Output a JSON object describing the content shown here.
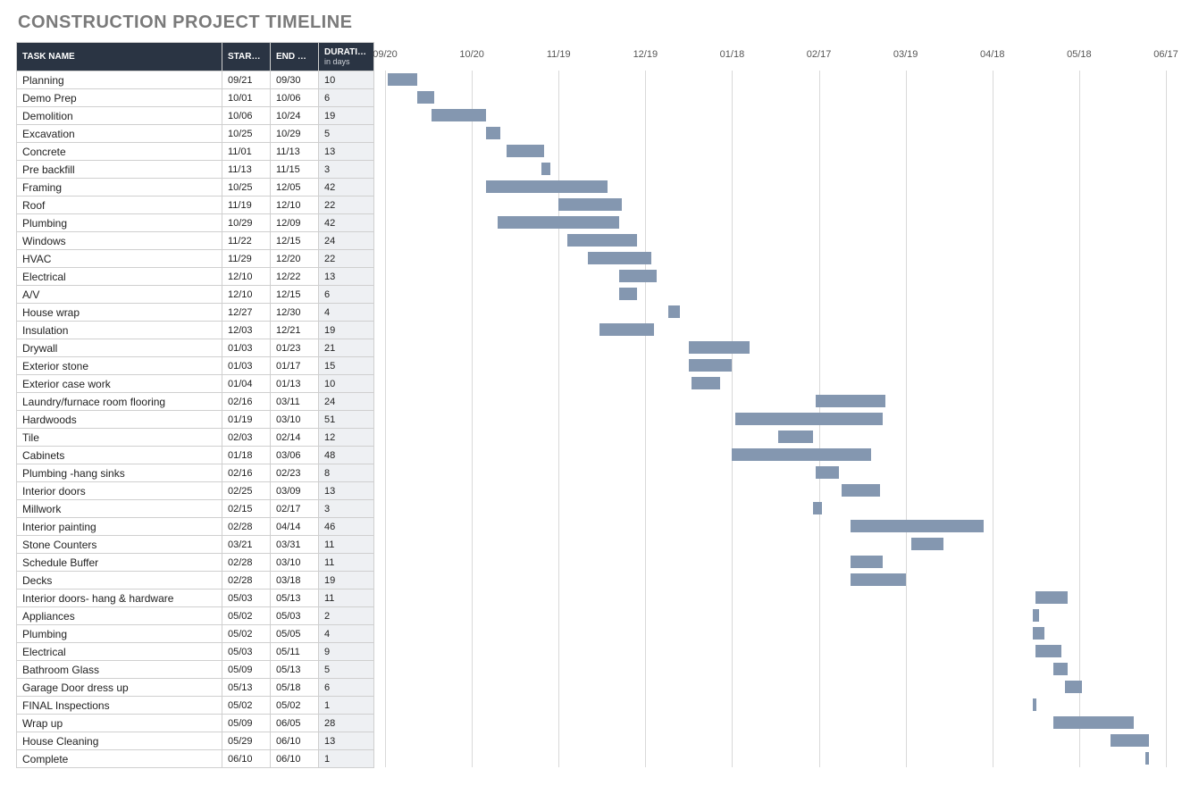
{
  "title": "CONSTRUCTION PROJECT TIMELINE",
  "columns": {
    "name": "TASK NAME",
    "start": "START DATE",
    "end": "END DATE",
    "duration": "DURATION",
    "duration_sub": "in days"
  },
  "chart_data": {
    "type": "gantt",
    "bar_color": "#8497b0",
    "axis_labels": [
      "09/20",
      "10/20",
      "11/19",
      "12/19",
      "01/18",
      "02/17",
      "03/19",
      "04/18",
      "05/18",
      "06/17"
    ],
    "tasks": [
      {
        "name": "Planning",
        "start": "09/21",
        "end": "09/30",
        "duration": 10
      },
      {
        "name": "Demo Prep",
        "start": "10/01",
        "end": "10/06",
        "duration": 6
      },
      {
        "name": "Demolition",
        "start": "10/06",
        "end": "10/24",
        "duration": 19
      },
      {
        "name": "Excavation",
        "start": "10/25",
        "end": "10/29",
        "duration": 5
      },
      {
        "name": "Concrete",
        "start": "11/01",
        "end": "11/13",
        "duration": 13
      },
      {
        "name": "Pre backfill",
        "start": "11/13",
        "end": "11/15",
        "duration": 3
      },
      {
        "name": "Framing",
        "start": "10/25",
        "end": "12/05",
        "duration": 42
      },
      {
        "name": "Roof",
        "start": "11/19",
        "end": "12/10",
        "duration": 22
      },
      {
        "name": "Plumbing",
        "start": "10/29",
        "end": "12/09",
        "duration": 42
      },
      {
        "name": "Windows",
        "start": "11/22",
        "end": "12/15",
        "duration": 24
      },
      {
        "name": "HVAC",
        "start": "11/29",
        "end": "12/20",
        "duration": 22
      },
      {
        "name": "Electrical",
        "start": "12/10",
        "end": "12/22",
        "duration": 13
      },
      {
        "name": "A/V",
        "start": "12/10",
        "end": "12/15",
        "duration": 6
      },
      {
        "name": "House wrap",
        "start": "12/27",
        "end": "12/30",
        "duration": 4
      },
      {
        "name": "Insulation",
        "start": "12/03",
        "end": "12/21",
        "duration": 19
      },
      {
        "name": "Drywall",
        "start": "01/03",
        "end": "01/23",
        "duration": 21
      },
      {
        "name": "Exterior stone",
        "start": "01/03",
        "end": "01/17",
        "duration": 15
      },
      {
        "name": "Exterior case work",
        "start": "01/04",
        "end": "01/13",
        "duration": 10
      },
      {
        "name": "Laundry/furnace room flooring",
        "start": "02/16",
        "end": "03/11",
        "duration": 24
      },
      {
        "name": "Hardwoods",
        "start": "01/19",
        "end": "03/10",
        "duration": 51
      },
      {
        "name": "Tile",
        "start": "02/03",
        "end": "02/14",
        "duration": 12
      },
      {
        "name": "Cabinets",
        "start": "01/18",
        "end": "03/06",
        "duration": 48
      },
      {
        "name": "Plumbing -hang sinks",
        "start": "02/16",
        "end": "02/23",
        "duration": 8
      },
      {
        "name": "Interior doors",
        "start": "02/25",
        "end": "03/09",
        "duration": 13
      },
      {
        "name": "Millwork",
        "start": "02/15",
        "end": "02/17",
        "duration": 3
      },
      {
        "name": "Interior painting",
        "start": "02/28",
        "end": "04/14",
        "duration": 46
      },
      {
        "name": "Stone Counters",
        "start": "03/21",
        "end": "03/31",
        "duration": 11
      },
      {
        "name": "Schedule Buffer",
        "start": "02/28",
        "end": "03/10",
        "duration": 11
      },
      {
        "name": "Decks",
        "start": "02/28",
        "end": "03/18",
        "duration": 19
      },
      {
        "name": "Interior doors- hang & hardware",
        "start": "05/03",
        "end": "05/13",
        "duration": 11
      },
      {
        "name": "Appliances",
        "start": "05/02",
        "end": "05/03",
        "duration": 2
      },
      {
        "name": "Plumbing",
        "start": "05/02",
        "end": "05/05",
        "duration": 4
      },
      {
        "name": "Electrical",
        "start": "05/03",
        "end": "05/11",
        "duration": 9
      },
      {
        "name": "Bathroom Glass",
        "start": "05/09",
        "end": "05/13",
        "duration": 5
      },
      {
        "name": "Garage Door dress up",
        "start": "05/13",
        "end": "05/18",
        "duration": 6
      },
      {
        "name": "FINAL Inspections",
        "start": "05/02",
        "end": "05/02",
        "duration": 1
      },
      {
        "name": "Wrap up",
        "start": "05/09",
        "end": "06/05",
        "duration": 28
      },
      {
        "name": "House Cleaning",
        "start": "05/29",
        "end": "06/10",
        "duration": 13
      },
      {
        "name": "Complete",
        "start": "06/10",
        "end": "06/10",
        "duration": 1
      }
    ]
  }
}
